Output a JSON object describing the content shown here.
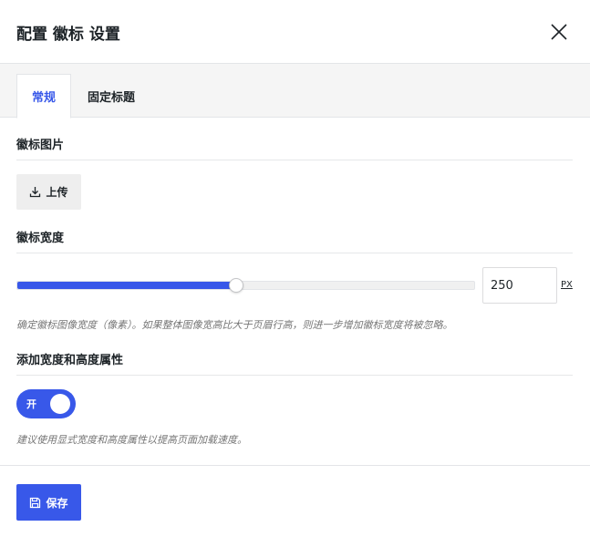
{
  "dialog": {
    "title": "配置 徽标 设置"
  },
  "tabs": [
    {
      "label": "常规",
      "active": true
    },
    {
      "label": "固定标题",
      "active": false
    }
  ],
  "logo_image": {
    "label": "徽标图片",
    "upload_label": "上传"
  },
  "logo_width": {
    "label": "徽标宽度",
    "value": "250",
    "unit": "PX",
    "slider_fraction": 0.48,
    "help": "确定徽标图像宽度（像素）。如果整体图像宽高比大于页眉行高，则进一步增加徽标宽度将被忽略。"
  },
  "dimensions_attr": {
    "label": "添加宽度和高度属性",
    "toggle_label": "开",
    "toggle_on": true,
    "help": "建议使用显式宽度和高度属性以提高页面加载速度。"
  },
  "footer": {
    "save_label": "保存"
  },
  "colors": {
    "accent": "#3858e9",
    "tab_bar_bg": "#f5f5f5",
    "upload_bg": "#eeeeee",
    "help_text": "#757575"
  },
  "icons": {
    "close": "close-icon",
    "upload": "download-arrow-icon",
    "save": "floppy-disk-icon"
  }
}
